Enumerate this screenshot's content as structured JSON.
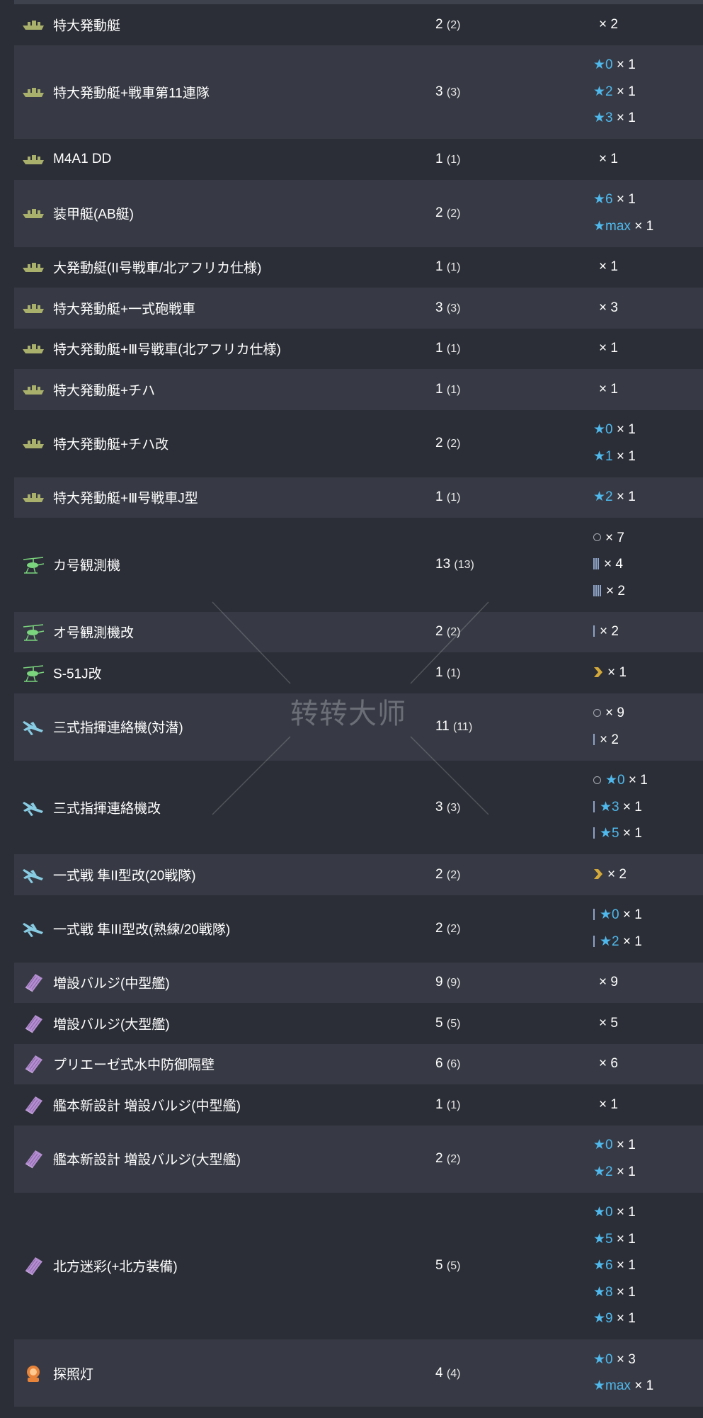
{
  "colors": {
    "background": "#2b2e36",
    "row_alt": "#373a44",
    "star": "#4fb8ec",
    "boat_icon": "#a9b06b",
    "autogyro_icon": "#7bd47e",
    "liaison_plane_icon": "#88cce4",
    "bulge_icon": "#b38ed0",
    "searchlight_icon": "#e8833a",
    "chevron": "#d4a93b"
  },
  "watermark": {
    "text": "转转大师"
  },
  "rows": [
    {
      "name": "特大発動艇",
      "count": "2",
      "count_paren": "(2)",
      "icon": "landing-craft-icon",
      "lines": [
        {
          "kind": "plain",
          "mult": "× 2"
        }
      ]
    },
    {
      "name": "特大発動艇+戦車第11連隊",
      "count": "3",
      "count_paren": "(3)",
      "icon": "landing-craft-icon",
      "lines": [
        {
          "kind": "star",
          "star": "★0",
          "mult": "× 1"
        },
        {
          "kind": "star",
          "star": "★2",
          "mult": "× 1"
        },
        {
          "kind": "star",
          "star": "★3",
          "mult": "× 1"
        }
      ]
    },
    {
      "name": "M4A1 DD",
      "count": "1",
      "count_paren": "(1)",
      "icon": "landing-craft-icon",
      "lines": [
        {
          "kind": "plain",
          "mult": "× 1"
        }
      ]
    },
    {
      "name": "装甲艇(AB艇)",
      "count": "2",
      "count_paren": "(2)",
      "icon": "landing-craft-icon",
      "lines": [
        {
          "kind": "star",
          "star": "★6",
          "mult": "× 1"
        },
        {
          "kind": "star",
          "star": "★max",
          "mult": "× 1"
        }
      ]
    },
    {
      "name": "大発動艇(II号戦車/北アフリカ仕様)",
      "count": "1",
      "count_paren": "(1)",
      "icon": "landing-craft-icon",
      "lines": [
        {
          "kind": "plain",
          "mult": "× 1"
        }
      ]
    },
    {
      "name": "特大発動艇+一式砲戦車",
      "count": "3",
      "count_paren": "(3)",
      "icon": "landing-craft-icon",
      "lines": [
        {
          "kind": "plain",
          "mult": "× 3"
        }
      ]
    },
    {
      "name": "特大発動艇+Ⅲ号戦車(北アフリカ仕様)",
      "count": "1",
      "count_paren": "(1)",
      "icon": "landing-craft-icon",
      "lines": [
        {
          "kind": "plain",
          "mult": "× 1"
        }
      ]
    },
    {
      "name": "特大発動艇+チハ",
      "count": "1",
      "count_paren": "(1)",
      "icon": "landing-craft-icon",
      "lines": [
        {
          "kind": "plain",
          "mult": "× 1"
        }
      ]
    },
    {
      "name": "特大発動艇+チハ改",
      "count": "2",
      "count_paren": "(2)",
      "icon": "landing-craft-icon",
      "lines": [
        {
          "kind": "star",
          "star": "★0",
          "mult": "× 1"
        },
        {
          "kind": "star",
          "star": "★1",
          "mult": "× 1"
        }
      ]
    },
    {
      "name": "特大発動艇+Ⅲ号戦車J型",
      "count": "1",
      "count_paren": "(1)",
      "icon": "landing-craft-icon",
      "lines": [
        {
          "kind": "star",
          "star": "★2",
          "mult": "× 1"
        }
      ]
    },
    {
      "name": "カ号観測機",
      "count": "13",
      "count_paren": "(13)",
      "icon": "autogyro-icon",
      "lines": [
        {
          "kind": "circle",
          "mult": "× 7"
        },
        {
          "kind": "bars",
          "bars": 3,
          "mult": "× 4"
        },
        {
          "kind": "bars",
          "bars": 4,
          "mult": "× 2"
        }
      ]
    },
    {
      "name": "オ号観測機改",
      "count": "2",
      "count_paren": "(2)",
      "icon": "autogyro-icon",
      "lines": [
        {
          "kind": "bars",
          "bars": 1,
          "mult": "× 2"
        }
      ]
    },
    {
      "name": "S-51J改",
      "count": "1",
      "count_paren": "(1)",
      "icon": "autogyro-icon",
      "lines": [
        {
          "kind": "chevron",
          "mult": "× 1"
        }
      ]
    },
    {
      "name": "三式指揮連絡機(対潜)",
      "count": "11",
      "count_paren": "(11)",
      "icon": "liaison-plane-icon",
      "lines": [
        {
          "kind": "circle",
          "mult": "× 9"
        },
        {
          "kind": "bars",
          "bars": 1,
          "mult": "× 2"
        }
      ]
    },
    {
      "name": "三式指揮連絡機改",
      "count": "3",
      "count_paren": "(3)",
      "icon": "liaison-plane-icon",
      "lines": [
        {
          "kind": "circle",
          "star": "★0",
          "mult": "× 1"
        },
        {
          "kind": "bars",
          "bars": 1,
          "star": "★3",
          "mult": "× 1"
        },
        {
          "kind": "bars",
          "bars": 1,
          "star": "★5",
          "mult": "× 1"
        }
      ]
    },
    {
      "name": "一式戦 隼II型改(20戦隊)",
      "count": "2",
      "count_paren": "(2)",
      "icon": "liaison-plane-icon",
      "lines": [
        {
          "kind": "chevron",
          "mult": "× 2"
        }
      ]
    },
    {
      "name": "一式戦 隼III型改(熟練/20戦隊)",
      "count": "2",
      "count_paren": "(2)",
      "icon": "liaison-plane-icon",
      "lines": [
        {
          "kind": "bars",
          "bars": 1,
          "star": "★0",
          "mult": "× 1"
        },
        {
          "kind": "bars",
          "bars": 1,
          "star": "★2",
          "mult": "× 1"
        }
      ]
    },
    {
      "name": "増設バルジ(中型艦)",
      "count": "9",
      "count_paren": "(9)",
      "icon": "bulge-icon",
      "lines": [
        {
          "kind": "plain",
          "mult": "× 9"
        }
      ]
    },
    {
      "name": "増設バルジ(大型艦)",
      "count": "5",
      "count_paren": "(5)",
      "icon": "bulge-icon",
      "lines": [
        {
          "kind": "plain",
          "mult": "× 5"
        }
      ]
    },
    {
      "name": "プリエーゼ式水中防御隔壁",
      "count": "6",
      "count_paren": "(6)",
      "icon": "bulge-icon",
      "lines": [
        {
          "kind": "plain",
          "mult": "× 6"
        }
      ]
    },
    {
      "name": "艦本新設計 増設バルジ(中型艦)",
      "count": "1",
      "count_paren": "(1)",
      "icon": "bulge-icon",
      "lines": [
        {
          "kind": "plain",
          "mult": "× 1"
        }
      ]
    },
    {
      "name": "艦本新設計 増設バルジ(大型艦)",
      "count": "2",
      "count_paren": "(2)",
      "icon": "bulge-icon",
      "lines": [
        {
          "kind": "star",
          "star": "★0",
          "mult": "× 1"
        },
        {
          "kind": "star",
          "star": "★2",
          "mult": "× 1"
        }
      ]
    },
    {
      "name": "北方迷彩(+北方装備)",
      "count": "5",
      "count_paren": "(5)",
      "icon": "bulge-icon",
      "lines": [
        {
          "kind": "star",
          "star": "★0",
          "mult": "× 1"
        },
        {
          "kind": "star",
          "star": "★5",
          "mult": "× 1"
        },
        {
          "kind": "star",
          "star": "★6",
          "mult": "× 1"
        },
        {
          "kind": "star",
          "star": "★8",
          "mult": "× 1"
        },
        {
          "kind": "star",
          "star": "★9",
          "mult": "× 1"
        }
      ]
    },
    {
      "name": "探照灯",
      "count": "4",
      "count_paren": "(4)",
      "icon": "searchlight-icon",
      "lines": [
        {
          "kind": "star",
          "star": "★0",
          "mult": "× 3"
        },
        {
          "kind": "star",
          "star": "★max",
          "mult": "× 1"
        }
      ]
    }
  ]
}
